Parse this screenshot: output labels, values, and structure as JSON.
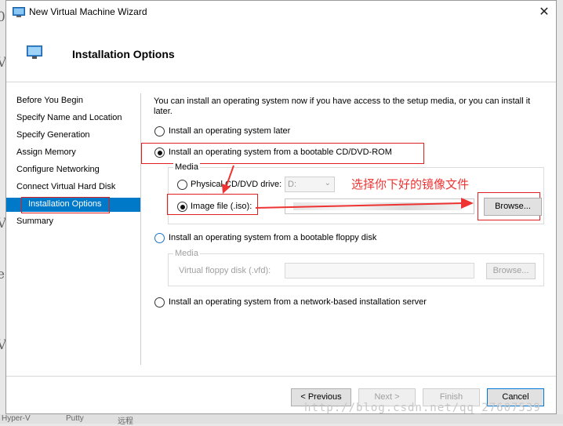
{
  "window": {
    "title": "New Virtual Machine Wizard",
    "close_glyph": "✕"
  },
  "header": {
    "title": "Installation Options"
  },
  "sidebar": {
    "items": [
      {
        "label": "Before You Begin"
      },
      {
        "label": "Specify Name and Location"
      },
      {
        "label": "Specify Generation"
      },
      {
        "label": "Assign Memory"
      },
      {
        "label": "Configure Networking"
      },
      {
        "label": "Connect Virtual Hard Disk"
      },
      {
        "label": "Installation Options",
        "active": true
      },
      {
        "label": "Summary"
      }
    ]
  },
  "main": {
    "intro": "You can install an operating system now if you have access to the setup media, or you can install it later.",
    "option_later": "Install an operating system later",
    "option_cd": "Install an operating system from a bootable CD/DVD-ROM",
    "media_label": "Media",
    "physical_drive_label": "Physical CD/DVD drive:",
    "physical_drive_value": "D:",
    "image_file_label": "Image file (.iso):",
    "browse_label": "Browse...",
    "option_floppy": "Install an operating system from a bootable floppy disk",
    "floppy_media_label": "Media",
    "floppy_file_label": "Virtual floppy disk (.vfd):",
    "floppy_browse_label": "Browse...",
    "option_network": "Install an operating system from a network-based installation server"
  },
  "annotation": {
    "text": "选择你下好的镜像文件"
  },
  "footer": {
    "previous": "< Previous",
    "next": "Next >",
    "finish": "Finish",
    "cancel": "Cancel"
  },
  "watermark": "http://blog.csdn.net/qq_27607539",
  "taskbar": {
    "items": [
      "Hyper-V",
      "Putty",
      "远程"
    ]
  },
  "colors": {
    "accent": "#0079c9",
    "annotation": "#e02020"
  }
}
